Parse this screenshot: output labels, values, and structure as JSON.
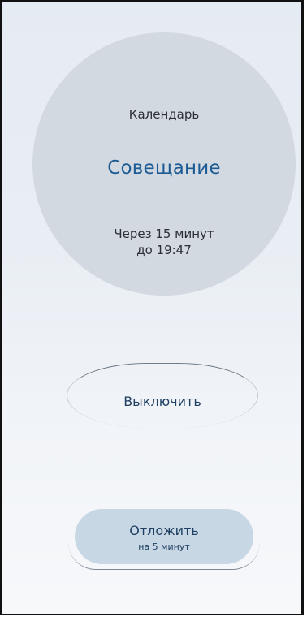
{
  "notification": {
    "source": "Календарь",
    "event_title": "Совещание",
    "time_line1": "Через 15 минут",
    "time_line2": "до 19:47"
  },
  "actions": {
    "dismiss_label": "Выключить",
    "snooze_label": "Отложить",
    "snooze_sublabel": "на 5 минут"
  },
  "colors": {
    "title": "#1d5b94",
    "circle": "#d3d9e1",
    "snooze_bg": "#c7d8e4"
  }
}
